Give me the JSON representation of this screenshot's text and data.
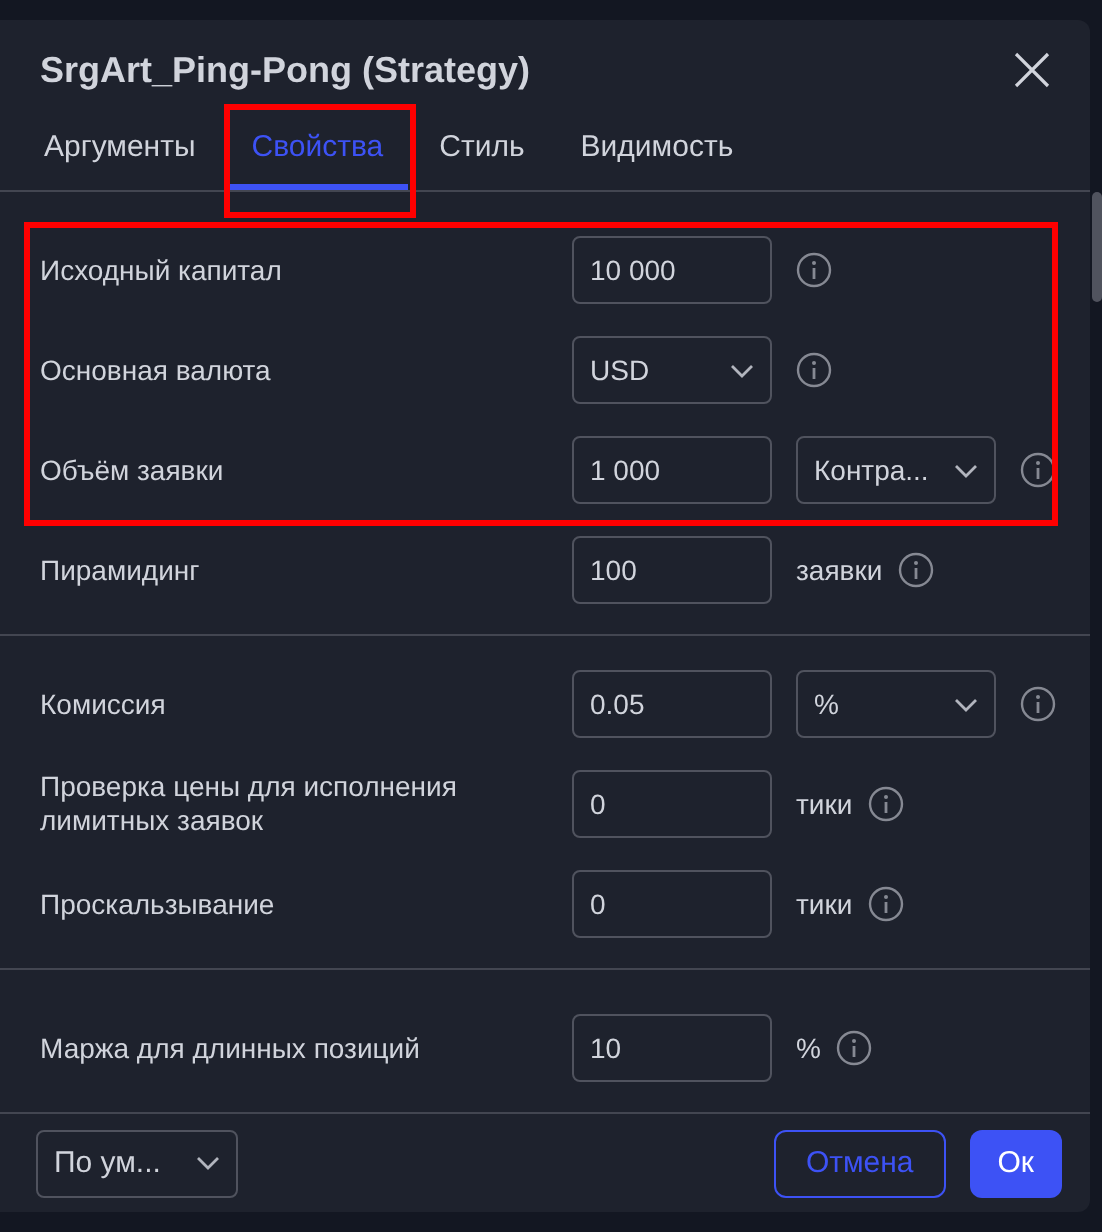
{
  "dialog": {
    "title": "SrgArt_Ping-Pong (Strategy)"
  },
  "tabs": [
    {
      "label": "Аргументы",
      "selected": false,
      "highlighted": false
    },
    {
      "label": "Свойства",
      "selected": true,
      "highlighted": true
    },
    {
      "label": "Стиль",
      "selected": false,
      "highlighted": false
    },
    {
      "label": "Видимость",
      "selected": false,
      "highlighted": false
    }
  ],
  "sections": [
    {
      "parts": [
        {
          "highlighted": true,
          "rows": [
            {
              "label": "Исходный капитал",
              "field": {
                "kind": "input",
                "value": "10 000"
              }
            },
            {
              "label": "Основная валюта",
              "field": {
                "kind": "select",
                "value": "USD"
              }
            },
            {
              "label": "Объём заявки",
              "field": {
                "kind": "input",
                "value": "1 000"
              },
              "extra": {
                "kind": "select",
                "text": "Контра..."
              }
            }
          ]
        },
        {
          "highlighted": false,
          "rows": [
            {
              "label": "Пирамидинг",
              "field": {
                "kind": "input",
                "value": "100"
              },
              "extra": {
                "kind": "unit",
                "text": "заявки"
              }
            }
          ]
        }
      ]
    },
    {
      "parts": [
        {
          "highlighted": false,
          "rows": [
            {
              "label": "Комиссия",
              "field": {
                "kind": "input",
                "value": "0.05"
              },
              "extra": {
                "kind": "select",
                "text": "%"
              }
            },
            {
              "label": "Проверка цены для исполнения лимитных заявок",
              "field": {
                "kind": "input",
                "value": "0"
              },
              "extra": {
                "kind": "unit",
                "text": "тики"
              }
            },
            {
              "label": "Проскальзывание",
              "field": {
                "kind": "input",
                "value": "0"
              },
              "extra": {
                "kind": "unit",
                "text": "тики"
              }
            }
          ]
        }
      ]
    },
    {
      "parts": [
        {
          "highlighted": false,
          "rows": [
            {
              "label": "Маржа для длинных позиций",
              "field": {
                "kind": "input",
                "value": "10"
              },
              "extra": {
                "kind": "unit",
                "text": "%"
              }
            }
          ]
        }
      ]
    }
  ],
  "footer": {
    "preset": "По ум...",
    "buttons": [
      {
        "label": "Отмена",
        "kind": "outline"
      },
      {
        "label": "Ок",
        "kind": "primary"
      }
    ]
  }
}
